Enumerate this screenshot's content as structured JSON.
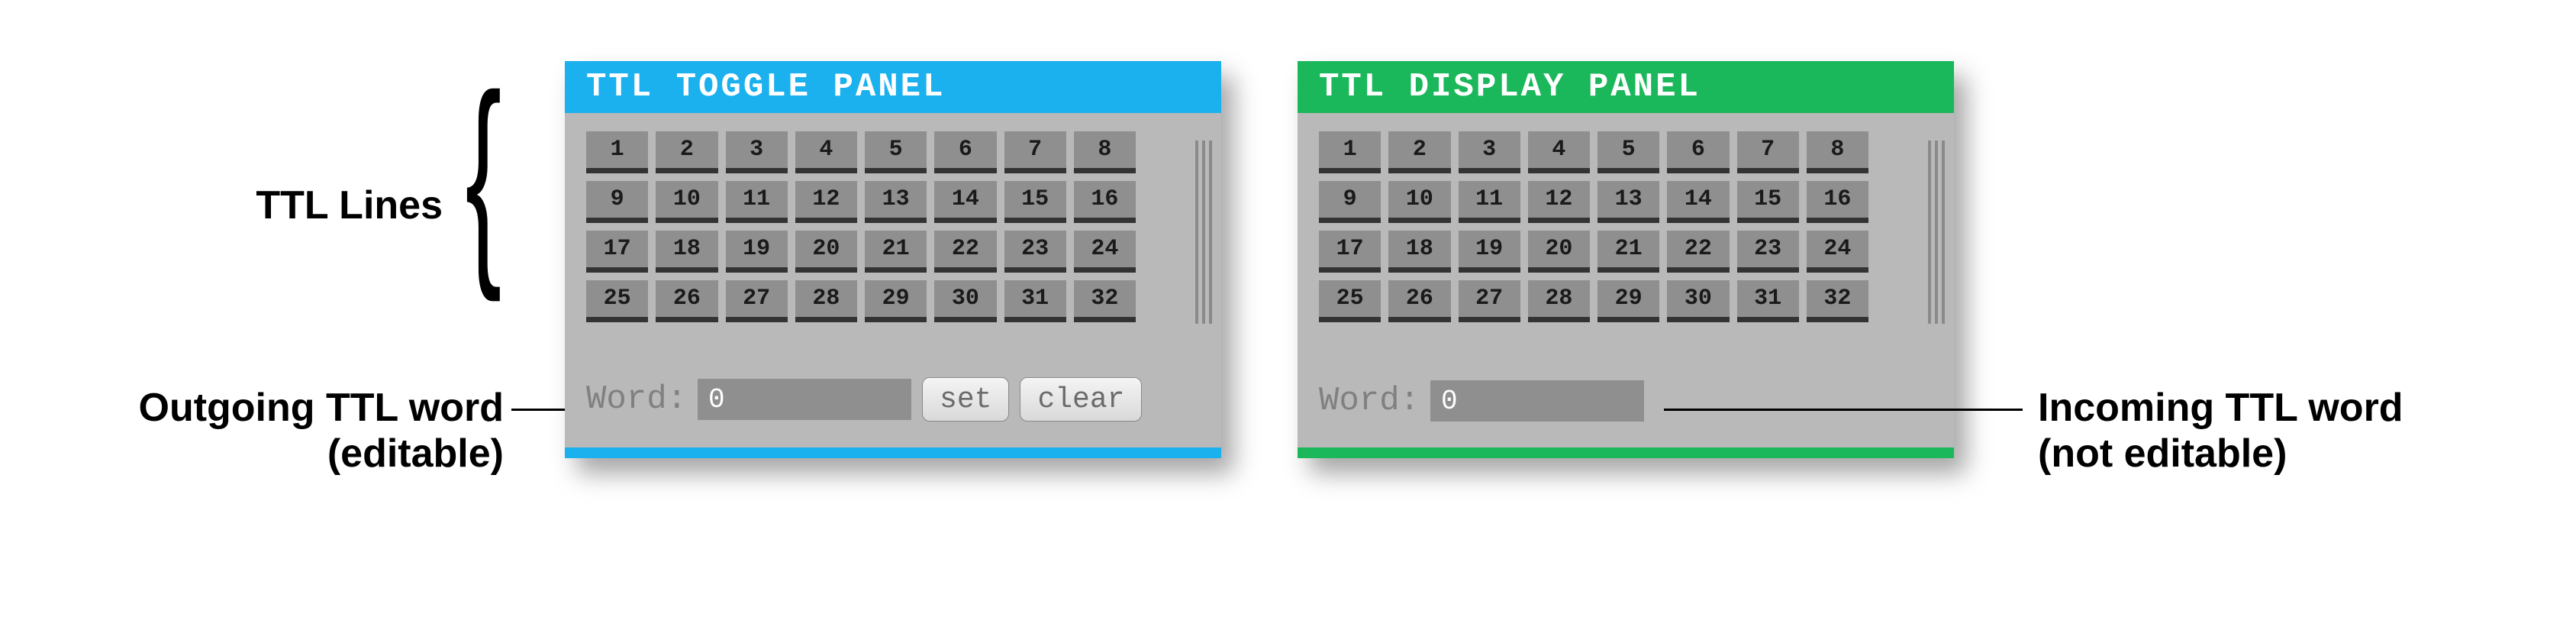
{
  "callouts": {
    "ttl_lines": "TTL Lines",
    "outgoing_l1": "Outgoing TTL word",
    "outgoing_l2": "(editable)",
    "incoming_l1": "Incoming TTL word",
    "incoming_l2": "(not editable)"
  },
  "toggle_panel": {
    "title": "TTL TOGGLE PANEL",
    "accent": "#1bb0ee",
    "bits": [
      "1",
      "2",
      "3",
      "4",
      "5",
      "6",
      "7",
      "8",
      "9",
      "10",
      "11",
      "12",
      "13",
      "14",
      "15",
      "16",
      "17",
      "18",
      "19",
      "20",
      "21",
      "22",
      "23",
      "24",
      "25",
      "26",
      "27",
      "28",
      "29",
      "30",
      "31",
      "32"
    ],
    "word_label": "Word:",
    "word_value": "0",
    "set_label": "set",
    "clear_label": "clear"
  },
  "display_panel": {
    "title": "TTL DISPLAY PANEL",
    "accent": "#1ab85a",
    "bits": [
      "1",
      "2",
      "3",
      "4",
      "5",
      "6",
      "7",
      "8",
      "9",
      "10",
      "11",
      "12",
      "13",
      "14",
      "15",
      "16",
      "17",
      "18",
      "19",
      "20",
      "21",
      "22",
      "23",
      "24",
      "25",
      "26",
      "27",
      "28",
      "29",
      "30",
      "31",
      "32"
    ],
    "word_label": "Word:",
    "word_value": "0"
  }
}
